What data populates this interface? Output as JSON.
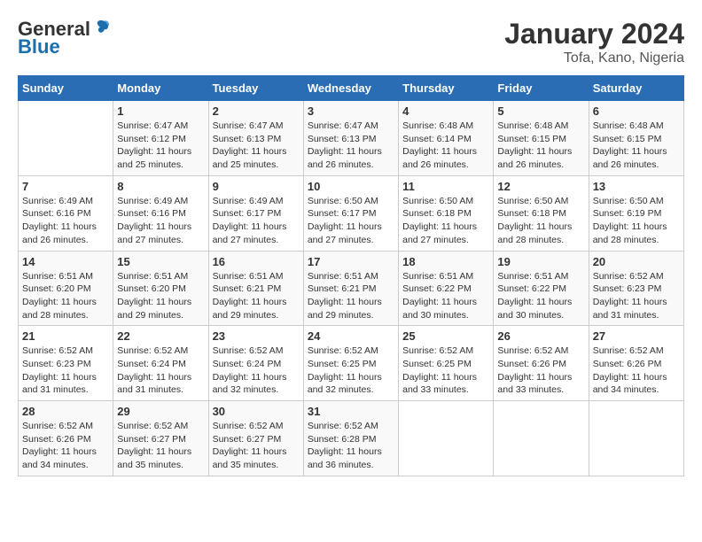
{
  "header": {
    "logo_general": "General",
    "logo_blue": "Blue",
    "month_year": "January 2024",
    "location": "Tofa, Kano, Nigeria"
  },
  "weekdays": [
    "Sunday",
    "Monday",
    "Tuesday",
    "Wednesday",
    "Thursday",
    "Friday",
    "Saturday"
  ],
  "weeks": [
    [
      {
        "day": "",
        "info": ""
      },
      {
        "day": "1",
        "info": "Sunrise: 6:47 AM\nSunset: 6:12 PM\nDaylight: 11 hours and 25 minutes."
      },
      {
        "day": "2",
        "info": "Sunrise: 6:47 AM\nSunset: 6:13 PM\nDaylight: 11 hours and 25 minutes."
      },
      {
        "day": "3",
        "info": "Sunrise: 6:47 AM\nSunset: 6:13 PM\nDaylight: 11 hours and 26 minutes."
      },
      {
        "day": "4",
        "info": "Sunrise: 6:48 AM\nSunset: 6:14 PM\nDaylight: 11 hours and 26 minutes."
      },
      {
        "day": "5",
        "info": "Sunrise: 6:48 AM\nSunset: 6:15 PM\nDaylight: 11 hours and 26 minutes."
      },
      {
        "day": "6",
        "info": "Sunrise: 6:48 AM\nSunset: 6:15 PM\nDaylight: 11 hours and 26 minutes."
      }
    ],
    [
      {
        "day": "7",
        "info": "Sunrise: 6:49 AM\nSunset: 6:16 PM\nDaylight: 11 hours and 26 minutes."
      },
      {
        "day": "8",
        "info": "Sunrise: 6:49 AM\nSunset: 6:16 PM\nDaylight: 11 hours and 27 minutes."
      },
      {
        "day": "9",
        "info": "Sunrise: 6:49 AM\nSunset: 6:17 PM\nDaylight: 11 hours and 27 minutes."
      },
      {
        "day": "10",
        "info": "Sunrise: 6:50 AM\nSunset: 6:17 PM\nDaylight: 11 hours and 27 minutes."
      },
      {
        "day": "11",
        "info": "Sunrise: 6:50 AM\nSunset: 6:18 PM\nDaylight: 11 hours and 27 minutes."
      },
      {
        "day": "12",
        "info": "Sunrise: 6:50 AM\nSunset: 6:18 PM\nDaylight: 11 hours and 28 minutes."
      },
      {
        "day": "13",
        "info": "Sunrise: 6:50 AM\nSunset: 6:19 PM\nDaylight: 11 hours and 28 minutes."
      }
    ],
    [
      {
        "day": "14",
        "info": "Sunrise: 6:51 AM\nSunset: 6:20 PM\nDaylight: 11 hours and 28 minutes."
      },
      {
        "day": "15",
        "info": "Sunrise: 6:51 AM\nSunset: 6:20 PM\nDaylight: 11 hours and 29 minutes."
      },
      {
        "day": "16",
        "info": "Sunrise: 6:51 AM\nSunset: 6:21 PM\nDaylight: 11 hours and 29 minutes."
      },
      {
        "day": "17",
        "info": "Sunrise: 6:51 AM\nSunset: 6:21 PM\nDaylight: 11 hours and 29 minutes."
      },
      {
        "day": "18",
        "info": "Sunrise: 6:51 AM\nSunset: 6:22 PM\nDaylight: 11 hours and 30 minutes."
      },
      {
        "day": "19",
        "info": "Sunrise: 6:51 AM\nSunset: 6:22 PM\nDaylight: 11 hours and 30 minutes."
      },
      {
        "day": "20",
        "info": "Sunrise: 6:52 AM\nSunset: 6:23 PM\nDaylight: 11 hours and 31 minutes."
      }
    ],
    [
      {
        "day": "21",
        "info": "Sunrise: 6:52 AM\nSunset: 6:23 PM\nDaylight: 11 hours and 31 minutes."
      },
      {
        "day": "22",
        "info": "Sunrise: 6:52 AM\nSunset: 6:24 PM\nDaylight: 11 hours and 31 minutes."
      },
      {
        "day": "23",
        "info": "Sunrise: 6:52 AM\nSunset: 6:24 PM\nDaylight: 11 hours and 32 minutes."
      },
      {
        "day": "24",
        "info": "Sunrise: 6:52 AM\nSunset: 6:25 PM\nDaylight: 11 hours and 32 minutes."
      },
      {
        "day": "25",
        "info": "Sunrise: 6:52 AM\nSunset: 6:25 PM\nDaylight: 11 hours and 33 minutes."
      },
      {
        "day": "26",
        "info": "Sunrise: 6:52 AM\nSunset: 6:26 PM\nDaylight: 11 hours and 33 minutes."
      },
      {
        "day": "27",
        "info": "Sunrise: 6:52 AM\nSunset: 6:26 PM\nDaylight: 11 hours and 34 minutes."
      }
    ],
    [
      {
        "day": "28",
        "info": "Sunrise: 6:52 AM\nSunset: 6:26 PM\nDaylight: 11 hours and 34 minutes."
      },
      {
        "day": "29",
        "info": "Sunrise: 6:52 AM\nSunset: 6:27 PM\nDaylight: 11 hours and 35 minutes."
      },
      {
        "day": "30",
        "info": "Sunrise: 6:52 AM\nSunset: 6:27 PM\nDaylight: 11 hours and 35 minutes."
      },
      {
        "day": "31",
        "info": "Sunrise: 6:52 AM\nSunset: 6:28 PM\nDaylight: 11 hours and 36 minutes."
      },
      {
        "day": "",
        "info": ""
      },
      {
        "day": "",
        "info": ""
      },
      {
        "day": "",
        "info": ""
      }
    ]
  ]
}
